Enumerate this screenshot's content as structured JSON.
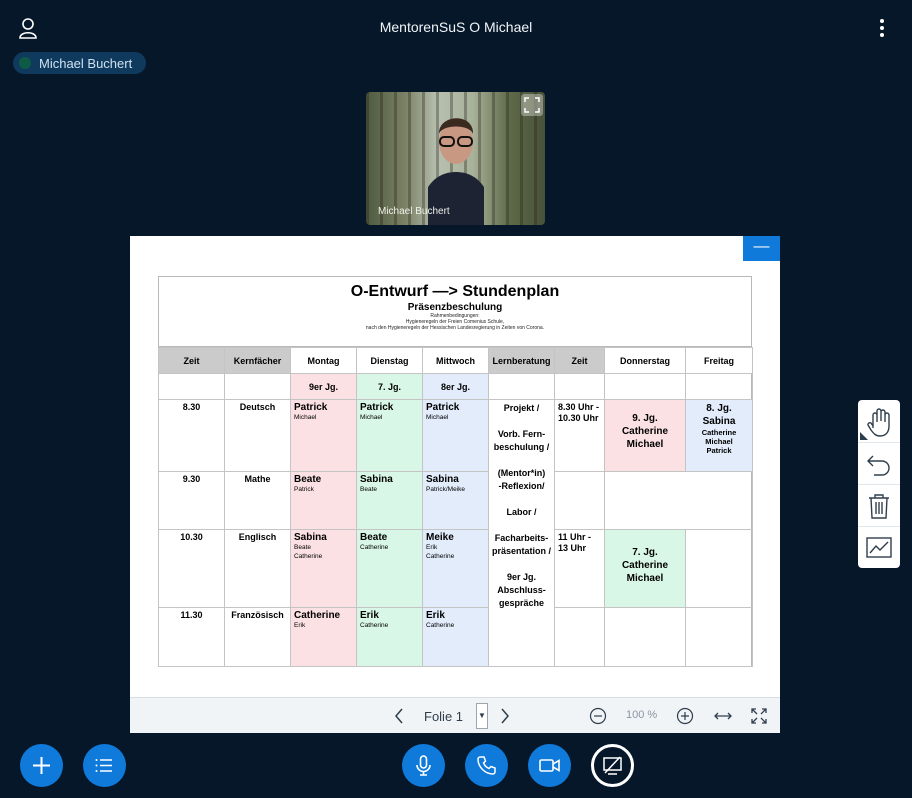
{
  "header": {
    "meeting_title": "MentorenSuS O Michael",
    "icons": [
      "user-icon",
      "more-options-icon"
    ]
  },
  "speaker": {
    "name": "Michael Buchert"
  },
  "video": {
    "participant_name": "Michael Buchert",
    "icons": [
      "expand-icon"
    ]
  },
  "slide": {
    "title": "O-Entwurf —> Stundenplan",
    "subtitle": "Präsenzbeschulung",
    "note_line1": "Rahmenbedingungen:",
    "note_line2": "Hygieneregeln der Freien Comenius Schule,",
    "note_line3": "nach den Hygieneregeln der Hessischen Landesregierung in Zeiten von Corona.",
    "headers": [
      "Zeit",
      "Kernfächer",
      "Montag",
      "Dienstag",
      "Mittwoch",
      "Lernberatung",
      "Zeit",
      "Donnerstag",
      "Freitag"
    ],
    "grades": {
      "montag": "9er Jg.",
      "dienstag": "7. Jg.",
      "mittwoch": "8er Jg."
    },
    "rows": [
      {
        "time": "8.30",
        "subject": "Deutsch",
        "mon": {
          "name": "Patrick",
          "sub": "Michael"
        },
        "tue": {
          "name": "Patrick",
          "sub": "Michael"
        },
        "wed": {
          "name": "Patrick",
          "sub": "Michael"
        }
      },
      {
        "time": "9.30",
        "subject": "Mathe",
        "mon": {
          "name": "Beate",
          "sub": "Patrick"
        },
        "tue": {
          "name": "Sabina",
          "sub": "Beate"
        },
        "wed": {
          "name": "Sabina",
          "sub": "Patrick/Meike"
        }
      },
      {
        "time": "10.30",
        "subject": "Englisch",
        "mon": {
          "name": "Sabina",
          "sub1": "Beate",
          "sub2": "Catherine"
        },
        "tue": {
          "name": "Beate",
          "sub": "Catherine"
        },
        "wed": {
          "name": "Meike",
          "sub1": "Erik",
          "sub2": "Catherine"
        }
      },
      {
        "time": "11.30",
        "subject": "Französisch",
        "mon": {
          "name": "Catherine",
          "sub": "Erik"
        },
        "tue": {
          "name": "Erik",
          "sub": "Catherine"
        },
        "wed": {
          "name": "Erik",
          "sub": "Catherine"
        }
      }
    ],
    "lernberatung": [
      "Projekt /",
      "Vorb. Fern-",
      "beschulung /",
      "(Mentor*in)",
      "-Reflexion/",
      "Labor /",
      "Facharbeits-",
      "präsentation /",
      "9er Jg.",
      "Abschluss-",
      "gespräche"
    ],
    "zeit2": {
      "slot1_a": "8.30 Uhr -",
      "slot1_b": "10.30 Uhr",
      "slot2_a": "11 Uhr -",
      "slot2_b": "13 Uhr"
    },
    "donnerstag": {
      "slot1": [
        "9. Jg.",
        "Catherine",
        "Michael"
      ],
      "slot2": [
        "7. Jg.",
        "Catherine",
        "Michael"
      ]
    },
    "freitag": {
      "slot1": [
        "8. Jg.",
        "Sabina",
        "Catherine",
        "Michael",
        "Patrick"
      ]
    }
  },
  "presentation_footer": {
    "slide_label": "Folie 1",
    "zoom": "100 %",
    "icons": [
      "prev-slide-icon",
      "next-slide-icon",
      "zoom-out-icon",
      "zoom-in-icon",
      "fit-width-icon",
      "fullscreen-icon"
    ]
  },
  "minimize_label": "—",
  "whiteboard_tools": [
    "hand-icon",
    "undo-icon",
    "trash-icon",
    "multi-user-whiteboard-icon"
  ],
  "bottom_actions": [
    "plus-icon",
    "list-icon",
    "microphone-icon",
    "phone-icon",
    "video-camera-icon",
    "screen-share-icon"
  ],
  "colors": {
    "background": "#06172a",
    "accent": "#0f7ad9",
    "pink": "#fbe1e4",
    "green": "#d9f7e6",
    "blue": "#e2ecfb"
  }
}
